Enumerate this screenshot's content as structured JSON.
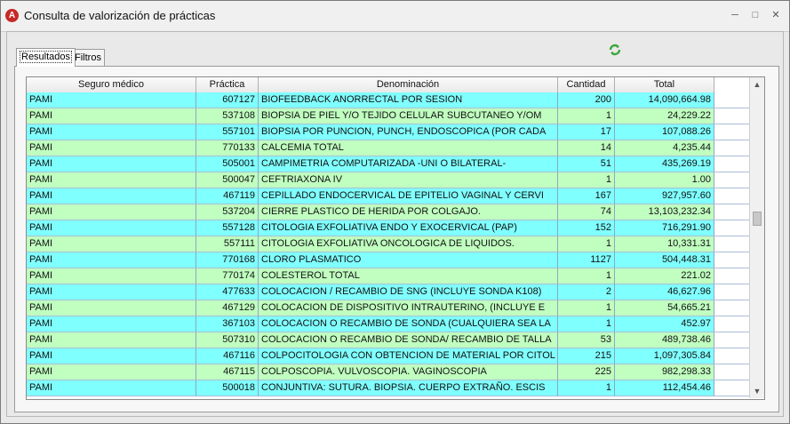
{
  "window": {
    "title": "Consulta de valorización de prácticas",
    "icon": "app-logo-icon"
  },
  "tabs": [
    {
      "label": "Resultados",
      "active": true
    },
    {
      "label": "Filtros",
      "active": false
    }
  ],
  "colors": {
    "row_cyan": "#80ffff",
    "row_green": "#c0ffc0"
  },
  "grid": {
    "columns": [
      "Seguro médico",
      "Práctica",
      "Denominación",
      "Cantidad",
      "Total"
    ],
    "rows": [
      [
        "PAMI",
        "607127",
        "BIOFEEDBACK ANORRECTAL POR SESION",
        "200",
        "14,090,664.98"
      ],
      [
        "PAMI",
        "537108",
        "BIOPSIA DE PIEL Y/O TEJIDO CELULAR SUBCUTANEO Y/OM",
        "1",
        "24,229.22"
      ],
      [
        "PAMI",
        "557101",
        "BIOPSIA POR PUNCION, PUNCH, ENDOSCOPICA (POR CADA",
        "17",
        "107,088.26"
      ],
      [
        "PAMI",
        "770133",
        "CALCEMIA TOTAL",
        "14",
        "4,235.44"
      ],
      [
        "PAMI",
        "505001",
        "CAMPIMETRIA COMPUTARIZADA -UNI O BILATERAL-",
        "51",
        "435,269.19"
      ],
      [
        "PAMI",
        "500047",
        "CEFTRIAXONA IV",
        "1",
        "1.00"
      ],
      [
        "PAMI",
        "467119",
        "CEPILLADO ENDOCERVICAL DE EPITELIO VAGINAL Y CERVI",
        "167",
        "927,957.60"
      ],
      [
        "PAMI",
        "537204",
        "CIERRE PLASTICO DE HERIDA POR COLGAJO.",
        "74",
        "13,103,232.34"
      ],
      [
        "PAMI",
        "557128",
        "CITOLOGIA EXFOLIATIVA ENDO Y EXOCERVICAL (PAP)",
        "152",
        "716,291.90"
      ],
      [
        "PAMI",
        "557111",
        "CITOLOGIA EXFOLIATIVA ONCOLOGICA DE LIQUIDOS.",
        "1",
        "10,331.31"
      ],
      [
        "PAMI",
        "770168",
        "CLORO PLASMATICO",
        "1127",
        "504,448.31"
      ],
      [
        "PAMI",
        "770174",
        "COLESTEROL TOTAL",
        "1",
        "221.02"
      ],
      [
        "PAMI",
        "477633",
        "COLOCACION / RECAMBIO DE SNG (INCLUYE SONDA K108)",
        "2",
        "46,627.96"
      ],
      [
        "PAMI",
        "467129",
        "COLOCACION DE DISPOSITIVO INTRAUTERINO, (INCLUYE E",
        "1",
        "54,665.21"
      ],
      [
        "PAMI",
        "367103",
        "COLOCACION O RECAMBIO DE SONDA (CUALQUIERA SEA LA",
        "1",
        "452.97"
      ],
      [
        "PAMI",
        "507310",
        "COLOCACION O RECAMBIO DE SONDA/ RECAMBIO DE TALLA",
        "53",
        "489,738.46"
      ],
      [
        "PAMI",
        "467116",
        "COLPOCITOLOGIA CON OBTENCION DE MATERIAL POR CITOL",
        "215",
        "1,097,305.84"
      ],
      [
        "PAMI",
        "467115",
        "COLPOSCOPIA. VULVOSCOPIA. VAGINOSCOPIA",
        "225",
        "982,298.33"
      ],
      [
        "PAMI",
        "500018",
        "CONJUNTIVA: SUTURA. BIOPSIA. CUERPO EXTRAÑO. ESCIS",
        "1",
        "112,454.46"
      ]
    ]
  }
}
